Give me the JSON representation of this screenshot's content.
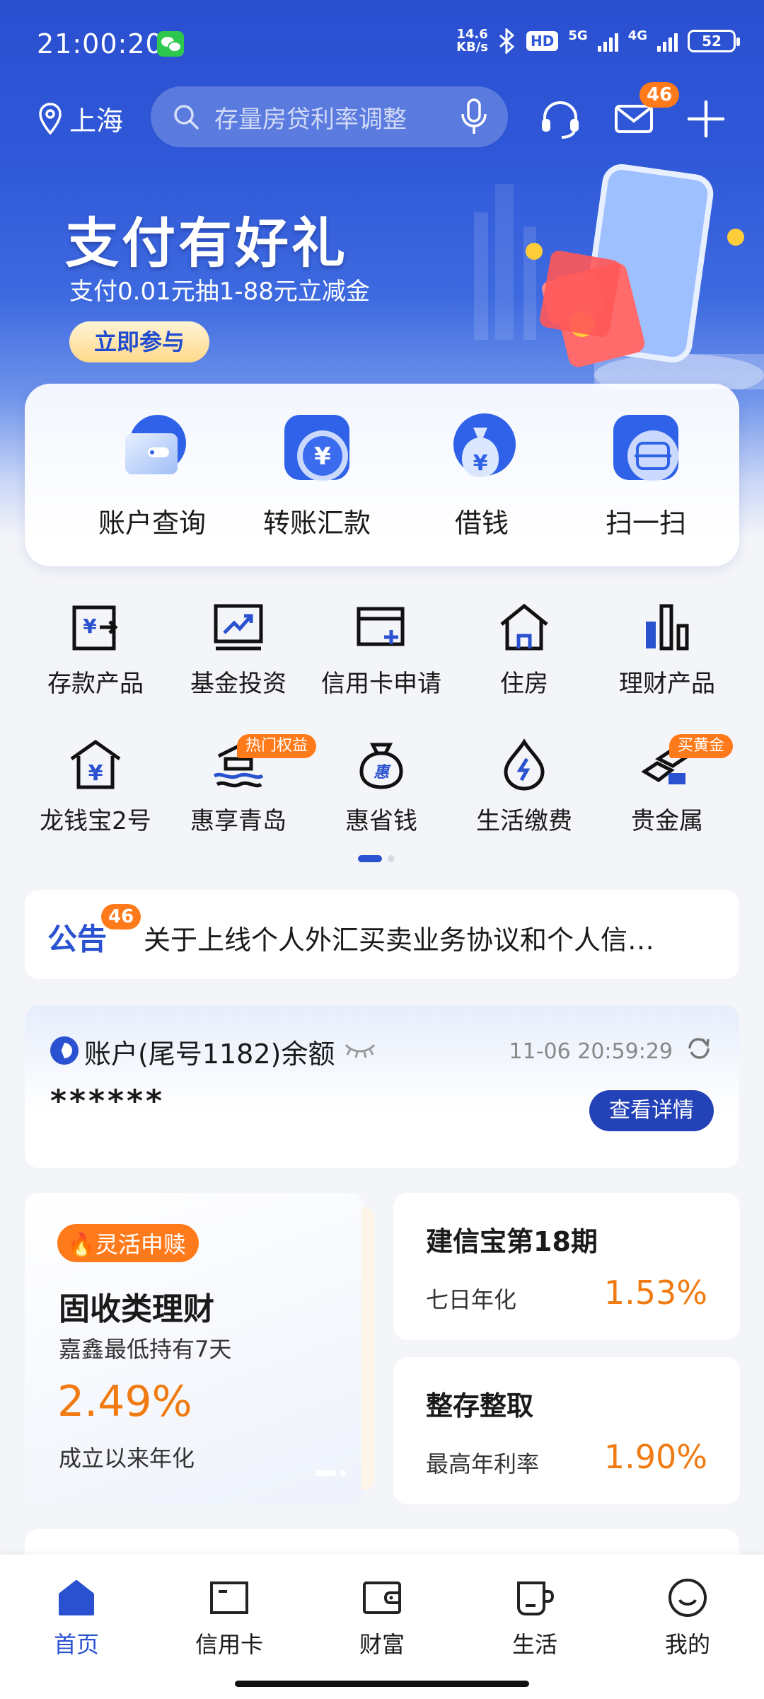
{
  "status_bar": {
    "time": "21:00:20",
    "net_speed_value": "14.6",
    "net_speed_unit": "KB/s",
    "hd_label": "HD",
    "sim1_label": "5G",
    "sim2_label": "4G",
    "battery": "52"
  },
  "header": {
    "location": "上海",
    "search_placeholder": "存量房贷利率调整",
    "mail_badge": "46"
  },
  "banner": {
    "title": "支付有好礼",
    "subtitle": "支付0.01元抽1-88元立减金",
    "button": "立即参与"
  },
  "quick_actions": [
    {
      "label": "账户查询",
      "icon": "wallet-icon"
    },
    {
      "label": "转账汇款",
      "icon": "yuan-transfer-icon"
    },
    {
      "label": "借钱",
      "icon": "money-bag-icon"
    },
    {
      "label": "扫一扫",
      "icon": "scan-icon"
    }
  ],
  "grid_row1": [
    {
      "label": "存款产品",
      "icon": "deposit-icon"
    },
    {
      "label": "基金投资",
      "icon": "fund-chart-icon"
    },
    {
      "label": "信用卡申请",
      "icon": "credit-card-add-icon"
    },
    {
      "label": "住房",
      "icon": "house-icon"
    },
    {
      "label": "理财产品",
      "icon": "bar-chart-icon"
    }
  ],
  "grid_row2": [
    {
      "label": "龙钱宝2号",
      "icon": "yuan-house-icon"
    },
    {
      "label": "惠享青岛",
      "icon": "qingdao-pavilion-icon",
      "tag": "热门权益"
    },
    {
      "label": "惠省钱",
      "icon": "hui-money-bag-icon"
    },
    {
      "label": "生活缴费",
      "icon": "utility-drop-icon"
    },
    {
      "label": "贵金属",
      "icon": "gold-bars-icon",
      "tag": "买黄金"
    }
  ],
  "notice": {
    "title": "公告",
    "badge": "46",
    "text": "关于上线个人外汇买卖业务协议和个人信…"
  },
  "account": {
    "label": "账户(尾号1182)余额",
    "timestamp": "11-06 20:59:29",
    "balance": "******",
    "detail_button": "查看详情"
  },
  "products": {
    "featured": {
      "tag": "灵活申赎",
      "title": "固收类理财",
      "subtitle": "嘉鑫最低持有7天",
      "rate": "2.49%",
      "rate_label": "成立以来年化"
    },
    "side": [
      {
        "title": "建信宝第18期",
        "key": "七日年化",
        "value": "1.53%"
      },
      {
        "title": "整存整取",
        "key": "最高年利率",
        "value": "1.90%"
      }
    ]
  },
  "tabs": [
    {
      "label": "首页",
      "icon": "home-icon",
      "active": true
    },
    {
      "label": "信用卡",
      "icon": "card-icon"
    },
    {
      "label": "财富",
      "icon": "wallet-icon"
    },
    {
      "label": "生活",
      "icon": "cup-icon"
    },
    {
      "label": "我的",
      "icon": "smile-icon"
    }
  ],
  "colors": {
    "brand_blue": "#2a52d0",
    "accent_orange": "#ff7a1a",
    "rate_orange": "#f07b12"
  }
}
